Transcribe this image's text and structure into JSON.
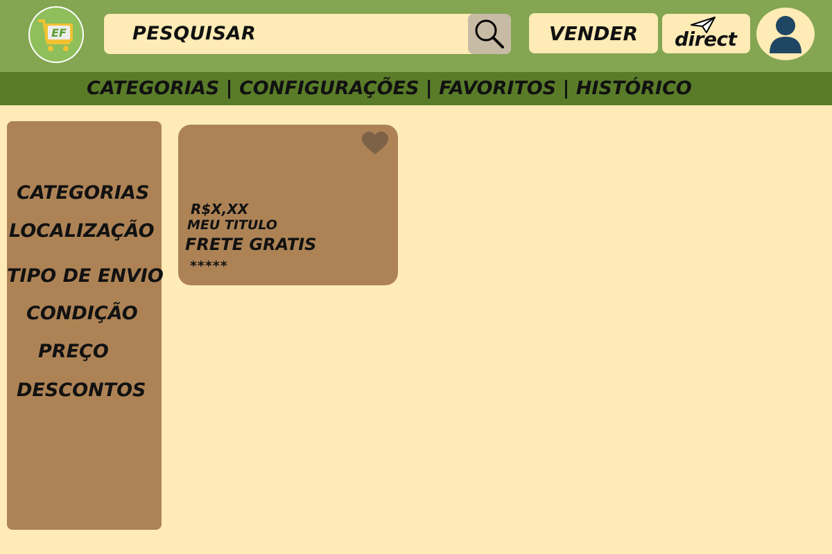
{
  "header": {
    "logo_text": "EF",
    "search": {
      "label": "PESQUISAR"
    },
    "sell_label": "VENDER",
    "direct_label": "direct"
  },
  "nav": {
    "items": [
      "CATEGORIAS",
      "CONFIGURAÇÕES",
      "FAVORITOS",
      "HISTÓRICO"
    ],
    "separator": " | "
  },
  "sidebar": {
    "items": [
      {
        "label": "CATEGORIAS"
      },
      {
        "label": "LOCALIZAÇÃO"
      },
      {
        "label": "TIPO DE ENVIO"
      },
      {
        "label": "CONDIÇÃO"
      },
      {
        "label": "PREÇO"
      },
      {
        "label": "DESCONTOS"
      }
    ]
  },
  "product": {
    "price": "R$X,XX",
    "title": "MEU TITULO",
    "shipping": "FRETE GRATIS",
    "rating": "*****"
  },
  "colors": {
    "header_bg": "#84A552",
    "nav_bg": "#5A7C29",
    "page_bg": "#FEEBB5",
    "panel_bg": "#AD8356",
    "search_button_bg": "#C7BBA5",
    "heart": "#7E6248",
    "avatar": "#1F4663"
  }
}
